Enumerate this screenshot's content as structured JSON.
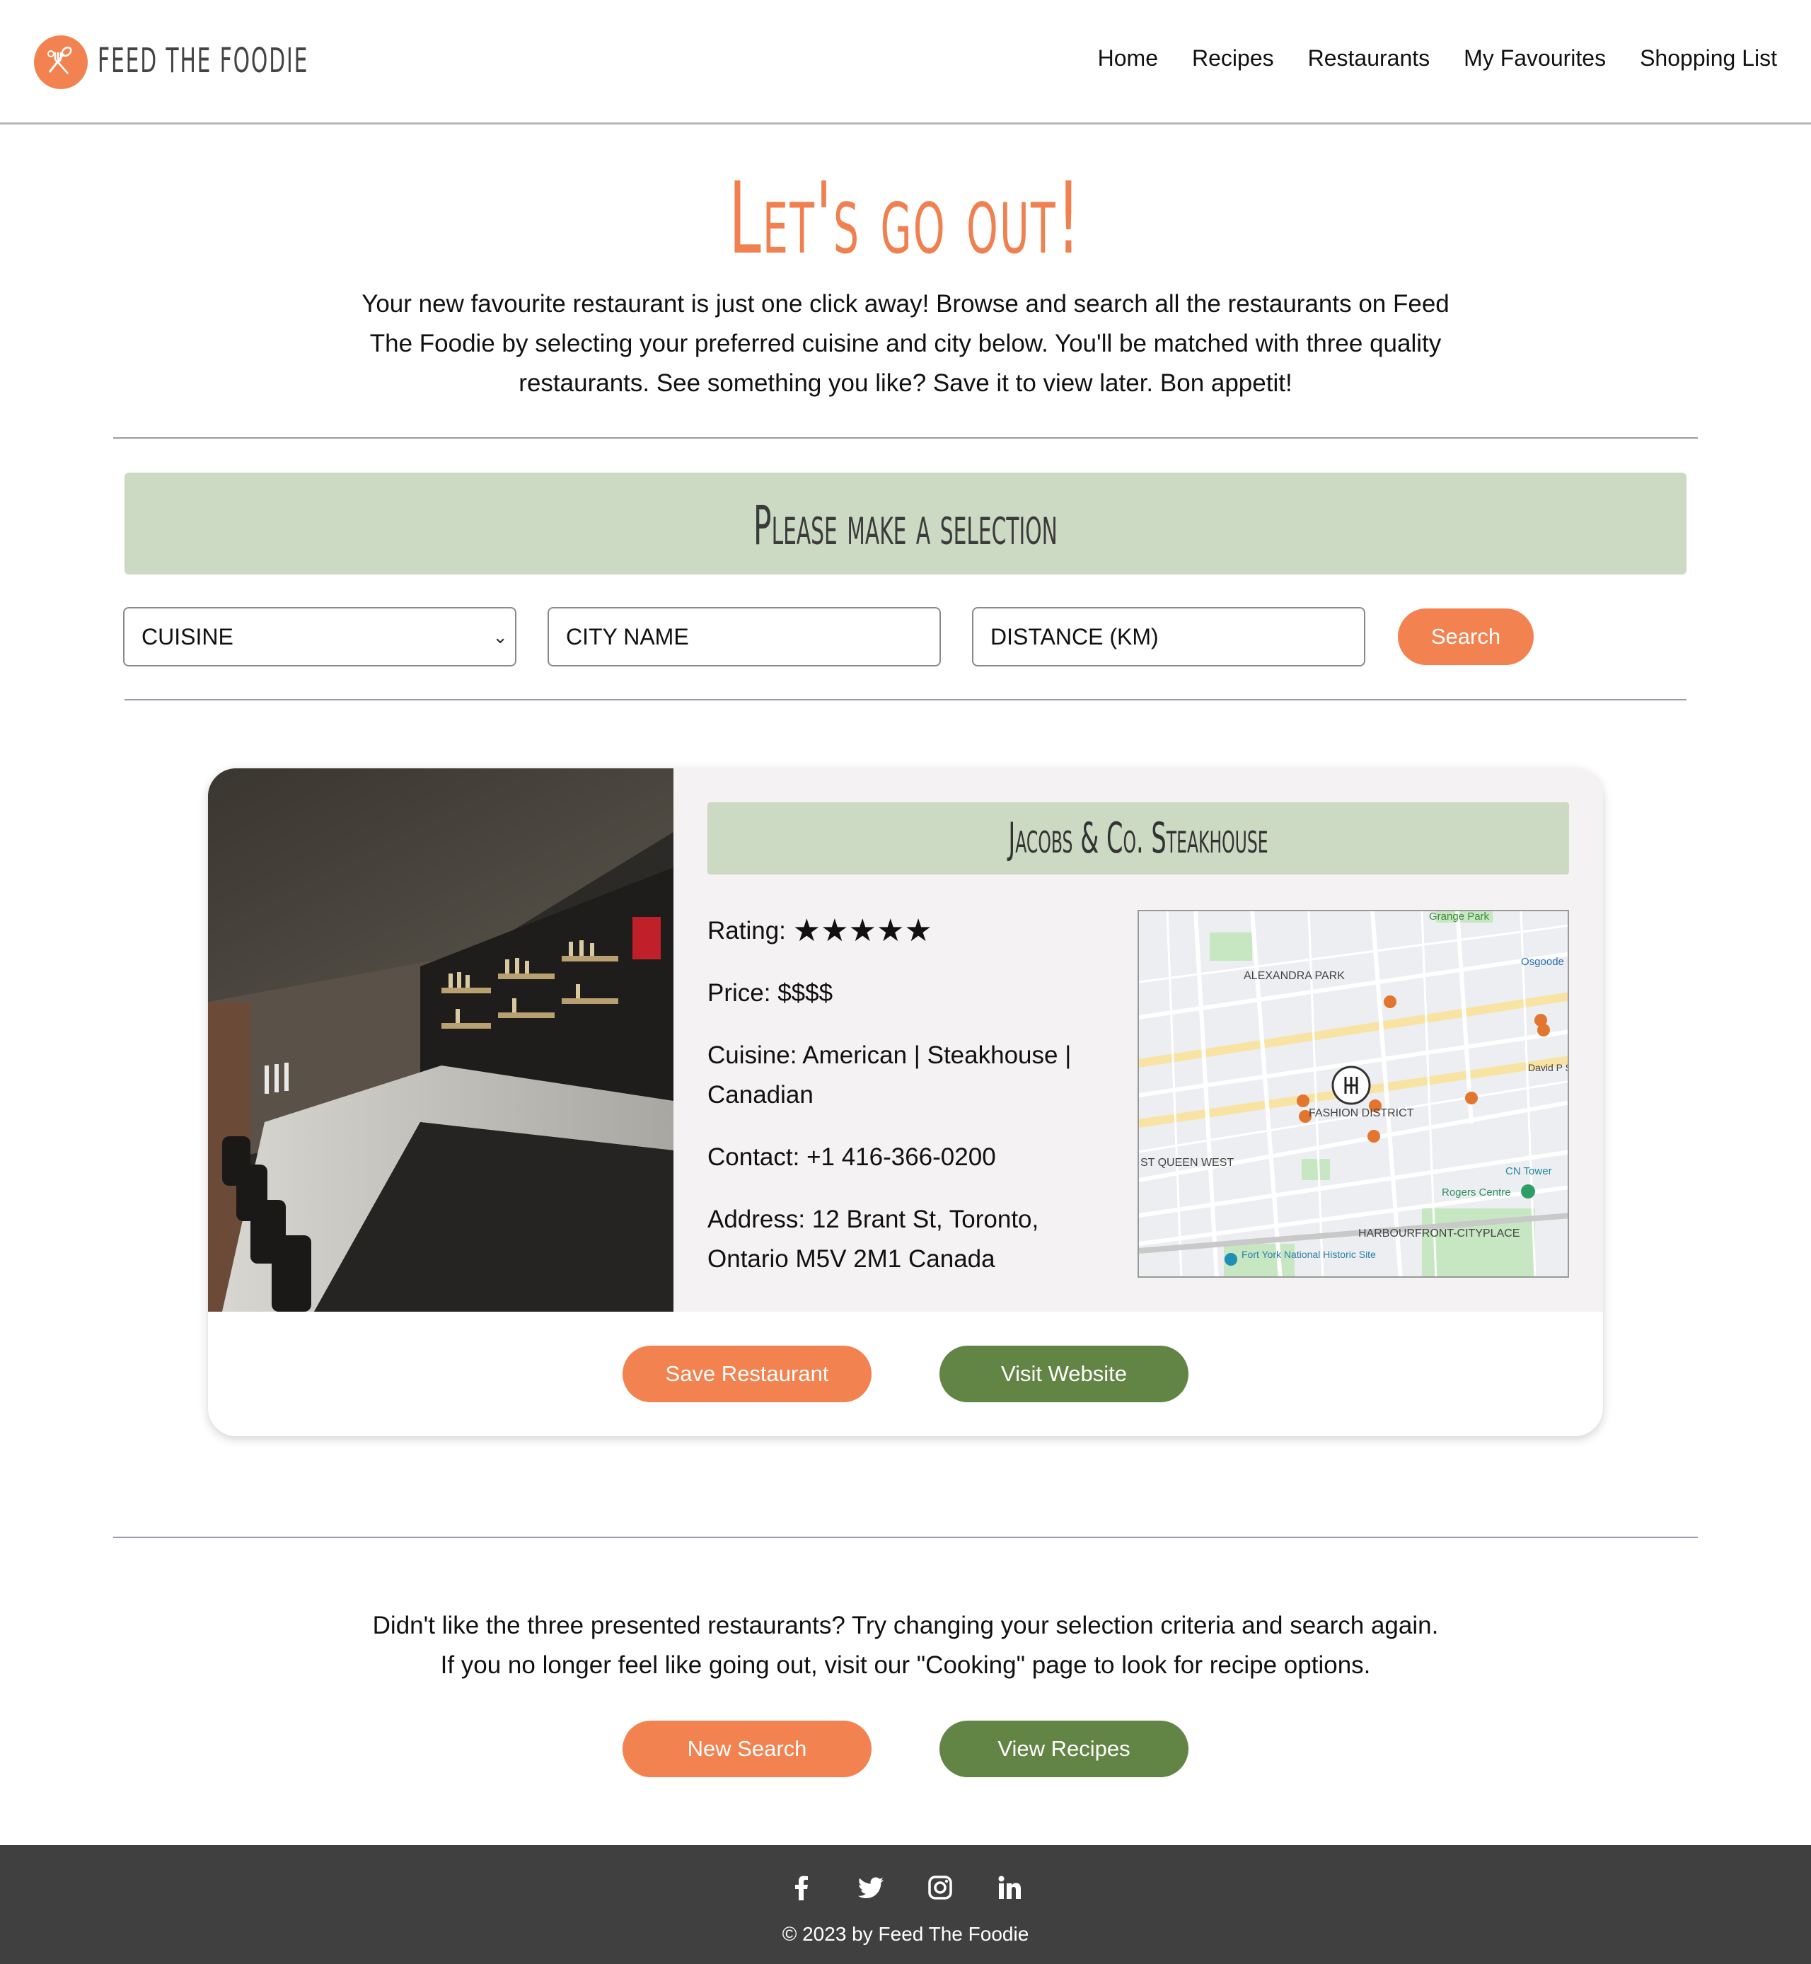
{
  "brand": {
    "name": "FEED THE FOODIE",
    "accent": "#f2824f",
    "green": "#628444",
    "sage": "#ccd9c3"
  },
  "nav": {
    "items": [
      "Home",
      "Recipes",
      "Restaurants",
      "My Favourites",
      "Shopping List"
    ]
  },
  "hero": {
    "title": "Let's go out!",
    "text": "Your new favourite restaurant is just one click away! Browse and search all the restaurants on Feed The Foodie by selecting your preferred cuisine and city below. You'll be matched with three quality restaurants. See something you like? Save it to view later. Bon appetit!"
  },
  "selection": {
    "heading": "Please make a selection",
    "cuisine_value": "CUISINE",
    "city_placeholder": "CITY NAME",
    "distance_placeholder": "DISTANCE (KM)",
    "search_label": "Search"
  },
  "restaurant": {
    "name": "Jacobs & Co. Steakhouse",
    "rating_label": "Rating:",
    "rating_stars": "★★★★★",
    "rating_value": 5,
    "price": "Price: $$$$",
    "cuisine": "Cuisine: American | Steakhouse | Canadian",
    "contact": "Contact: +1 416-366-0200",
    "address": "Address: 12 Brant St, Toronto, Ontario M5V 2M1 Canada",
    "save_label": "Save Restaurant",
    "website_label": "Visit Website",
    "map_labels": {
      "grange": "Grange Park",
      "osgoode": "Osgoode",
      "alexandra": "ALEXANDRA PARK",
      "fashion": "FASHION DISTRICT",
      "queen_west": "ST QUEEN WEST",
      "harbourfront": "HARBOURFRONT-CITYPLACE",
      "cn_tower": "CN Tower",
      "rogers": "Rogers Centre",
      "fort_york": "Fort York National Historic Site",
      "david": "David P Squa"
    }
  },
  "bottom": {
    "line1": "Didn't like the three presented restaurants? Try changing your selection criteria and search again.",
    "line2": "If you no longer feel like going out, visit our \"Cooking\" page to look for recipe options.",
    "new_search_label": "New Search",
    "view_recipes_label": "View Recipes"
  },
  "footer": {
    "icons": [
      "facebook-icon",
      "twitter-icon",
      "instagram-icon",
      "linkedin-icon"
    ],
    "copyright": "© 2023 by Feed The Foodie"
  }
}
